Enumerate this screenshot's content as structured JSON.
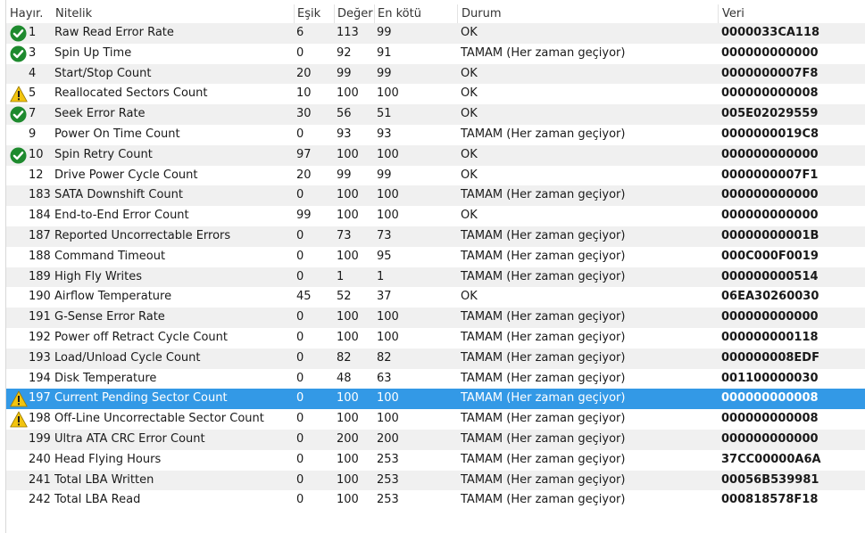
{
  "columns": {
    "no": "Hayır.",
    "attribute": "Nitelik",
    "threshold": "Eşik",
    "value": "Değer",
    "worst": "En kötü",
    "status": "Durum",
    "raw": "Veri"
  },
  "colors": {
    "selected_row": "#3399e6",
    "alt_row": "#f0f0f0",
    "ok_icon": "#1e8a2e",
    "warn_icon": "#f2c40f"
  },
  "rows": [
    {
      "icon": "check-icon",
      "id": "1",
      "name": "Raw Read Error Rate",
      "threshold": "6",
      "value": "113",
      "worst": "99",
      "status": "OK",
      "raw": "0000033CA118"
    },
    {
      "icon": "check-icon",
      "id": "3",
      "name": "Spin Up Time",
      "threshold": "0",
      "value": "92",
      "worst": "91",
      "status": "TAMAM (Her zaman geçiyor)",
      "raw": "000000000000"
    },
    {
      "icon": "",
      "id": "4",
      "name": "Start/Stop Count",
      "threshold": "20",
      "value": "99",
      "worst": "99",
      "status": "OK",
      "raw": "0000000007F8"
    },
    {
      "icon": "warning-icon",
      "id": "5",
      "name": "Reallocated Sectors Count",
      "threshold": "10",
      "value": "100",
      "worst": "100",
      "status": "OK",
      "raw": "000000000008"
    },
    {
      "icon": "check-icon",
      "id": "7",
      "name": "Seek Error Rate",
      "threshold": "30",
      "value": "56",
      "worst": "51",
      "status": "OK",
      "raw": "005E02029559"
    },
    {
      "icon": "",
      "id": "9",
      "name": "Power On Time Count",
      "threshold": "0",
      "value": "93",
      "worst": "93",
      "status": "TAMAM (Her zaman geçiyor)",
      "raw": "0000000019C8"
    },
    {
      "icon": "check-icon",
      "id": "10",
      "name": "Spin Retry Count",
      "threshold": "97",
      "value": "100",
      "worst": "100",
      "status": "OK",
      "raw": "000000000000"
    },
    {
      "icon": "",
      "id": "12",
      "name": "Drive Power Cycle Count",
      "threshold": "20",
      "value": "99",
      "worst": "99",
      "status": "OK",
      "raw": "0000000007F1"
    },
    {
      "icon": "",
      "id": "183",
      "name": "SATA Downshift Count",
      "threshold": "0",
      "value": "100",
      "worst": "100",
      "status": "TAMAM (Her zaman geçiyor)",
      "raw": "000000000000"
    },
    {
      "icon": "",
      "id": "184",
      "name": "End-to-End Error Count",
      "threshold": "99",
      "value": "100",
      "worst": "100",
      "status": "OK",
      "raw": "000000000000"
    },
    {
      "icon": "",
      "id": "187",
      "name": "Reported Uncorrectable Errors",
      "threshold": "0",
      "value": "73",
      "worst": "73",
      "status": "TAMAM (Her zaman geçiyor)",
      "raw": "00000000001B"
    },
    {
      "icon": "",
      "id": "188",
      "name": "Command Timeout",
      "threshold": "0",
      "value": "100",
      "worst": "95",
      "status": "TAMAM (Her zaman geçiyor)",
      "raw": "000C000F0019"
    },
    {
      "icon": "",
      "id": "189",
      "name": "High Fly Writes",
      "threshold": "0",
      "value": "1",
      "worst": "1",
      "status": "TAMAM (Her zaman geçiyor)",
      "raw": "000000000514"
    },
    {
      "icon": "",
      "id": "190",
      "name": "Airflow Temperature",
      "threshold": "45",
      "value": "52",
      "worst": "37",
      "status": "OK",
      "raw": "06EA30260030"
    },
    {
      "icon": "",
      "id": "191",
      "name": "G-Sense Error Rate",
      "threshold": "0",
      "value": "100",
      "worst": "100",
      "status": "TAMAM (Her zaman geçiyor)",
      "raw": "000000000000"
    },
    {
      "icon": "",
      "id": "192",
      "name": "Power off Retract Cycle Count",
      "threshold": "0",
      "value": "100",
      "worst": "100",
      "status": "TAMAM (Her zaman geçiyor)",
      "raw": "000000000118"
    },
    {
      "icon": "",
      "id": "193",
      "name": "Load/Unload Cycle Count",
      "threshold": "0",
      "value": "82",
      "worst": "82",
      "status": "TAMAM (Her zaman geçiyor)",
      "raw": "000000008EDF"
    },
    {
      "icon": "",
      "id": "194",
      "name": "Disk Temperature",
      "threshold": "0",
      "value": "48",
      "worst": "63",
      "status": "TAMAM (Her zaman geçiyor)",
      "raw": "001100000030"
    },
    {
      "icon": "warning-icon",
      "id": "197",
      "name": "Current Pending Sector Count",
      "threshold": "0",
      "value": "100",
      "worst": "100",
      "status": "TAMAM (Her zaman geçiyor)",
      "raw": "000000000008",
      "selected": true
    },
    {
      "icon": "warning-icon",
      "id": "198",
      "name": "Off-Line Uncorrectable Sector Count",
      "threshold": "0",
      "value": "100",
      "worst": "100",
      "status": "TAMAM (Her zaman geçiyor)",
      "raw": "000000000008"
    },
    {
      "icon": "",
      "id": "199",
      "name": "Ultra ATA CRC Error Count",
      "threshold": "0",
      "value": "200",
      "worst": "200",
      "status": "TAMAM (Her zaman geçiyor)",
      "raw": "000000000000"
    },
    {
      "icon": "",
      "id": "240",
      "name": "Head Flying Hours",
      "threshold": "0",
      "value": "100",
      "worst": "253",
      "status": "TAMAM (Her zaman geçiyor)",
      "raw": "37CC00000A6A"
    },
    {
      "icon": "",
      "id": "241",
      "name": "Total LBA Written",
      "threshold": "0",
      "value": "100",
      "worst": "253",
      "status": "TAMAM (Her zaman geçiyor)",
      "raw": "00056B539981"
    },
    {
      "icon": "",
      "id": "242",
      "name": "Total LBA Read",
      "threshold": "0",
      "value": "100",
      "worst": "253",
      "status": "TAMAM (Her zaman geçiyor)",
      "raw": "000818578F18"
    }
  ]
}
